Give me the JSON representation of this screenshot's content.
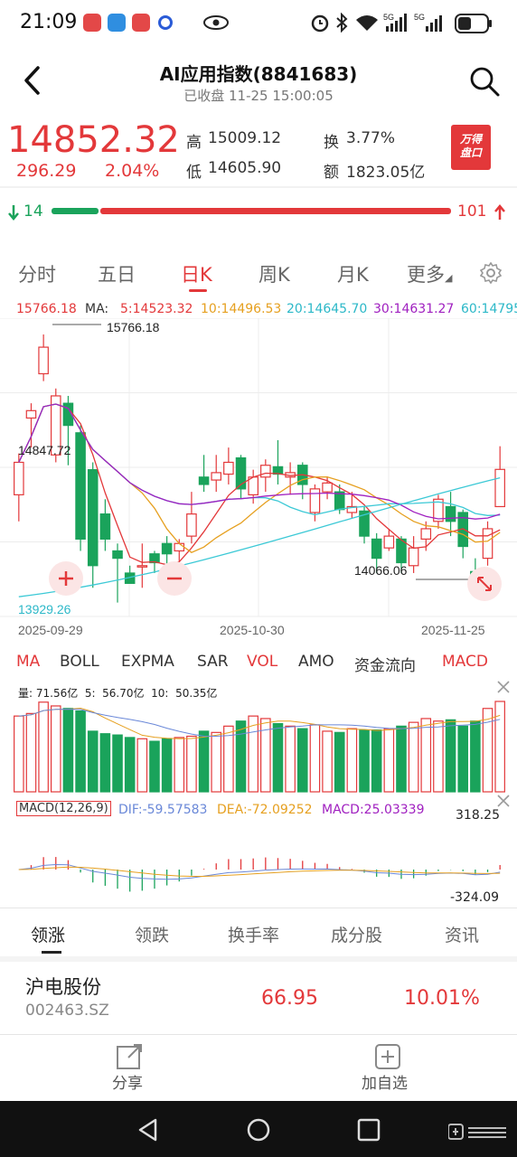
{
  "status": {
    "time": "21:09"
  },
  "header": {
    "title": "AI应用指数(8841683)",
    "subtitle": "已收盘 11-25 15:00:05"
  },
  "quote": {
    "price": "14852.32",
    "change": "296.29",
    "change_pct": "2.04%",
    "high_label": "高",
    "high": "15009.12",
    "low_label": "低",
    "low": "14605.90",
    "turnover_label": "换",
    "turnover": "3.77%",
    "amount_label": "额",
    "amount": "1823.05亿",
    "badge": "万得盘口"
  },
  "breadth": {
    "down": "14",
    "up": "101"
  },
  "period_tabs": [
    "分时",
    "五日",
    "日K",
    "周K",
    "月K",
    "更多"
  ],
  "period_active": "日K",
  "ma_legend": {
    "top_value": "15766.18",
    "ma_label": "MA:",
    "ma5": "5:14523.32",
    "ma10": "10:14496.53",
    "ma20": "20:14645.70",
    "ma30": "30:14631.27",
    "ma60": "60:14795"
  },
  "kchart_labels": {
    "high_mark": "15766.18",
    "mid_level": "14847.72",
    "low_level": "13929.26",
    "low_mark": "14066.06",
    "date1": "2025-09-29",
    "date2": "2025-10-30",
    "date3": "2025-11-25"
  },
  "indicator_tabs": [
    "MA",
    "BOLL",
    "EXPMA",
    "SAR",
    "VOL",
    "AMO",
    "资金流向",
    "MACD"
  ],
  "volume": {
    "label": "量: 71.56亿  5:  56.70亿  10:  50.35亿"
  },
  "macd": {
    "title": "MACD(12,26,9)",
    "dif": "DIF:-59.57583",
    "dea": "DEA:-72.09252",
    "macd": "MACD:25.03339",
    "max": "318.25",
    "min": "-324.09"
  },
  "bottom_tabs": [
    "领涨",
    "领跌",
    "换手率",
    "成分股",
    "资讯"
  ],
  "bottom_active": "领涨",
  "leader": {
    "name": "沪电股份",
    "code": "002463.SZ",
    "price": "66.95",
    "pct": "10.01%"
  },
  "actions": {
    "share": "分享",
    "add": "加自选"
  },
  "colors": {
    "up": "#e3383a",
    "down": "#1aa35b",
    "ma5": "#e3383a",
    "ma10": "#e6a020",
    "ma20": "#3cc9d6",
    "ma30": "#a020c0"
  },
  "chart_data": [
    {
      "type": "candlestick",
      "title": "",
      "ylim": [
        13929.26,
        15766.18
      ],
      "x_ticks": [
        "2025-09-29",
        "2025-10-30",
        "2025-11-25"
      ],
      "candles": [
        {
          "o": 14680,
          "c": 14900,
          "h": 14960,
          "l": 14500
        },
        {
          "o": 15200,
          "c": 15250,
          "h": 15300,
          "l": 15000
        },
        {
          "o": 15500,
          "c": 15680,
          "h": 15766,
          "l": 15450
        },
        {
          "o": 14950,
          "c": 15350,
          "h": 15400,
          "l": 14900
        },
        {
          "o": 15300,
          "c": 15150,
          "h": 15350,
          "l": 14880
        },
        {
          "o": 15100,
          "c": 14380,
          "h": 15150,
          "l": 14300
        },
        {
          "o": 14850,
          "c": 14200,
          "h": 14900,
          "l": 14050
        },
        {
          "o": 14550,
          "c": 14380,
          "h": 14650,
          "l": 14300
        },
        {
          "o": 14300,
          "c": 14250,
          "h": 14350,
          "l": 13950
        },
        {
          "o": 14150,
          "c": 14080,
          "h": 14200,
          "l": 14080
        },
        {
          "o": 14200,
          "c": 14200,
          "h": 14350,
          "l": 14050
        },
        {
          "o": 14280,
          "c": 14220,
          "h": 14300,
          "l": 14150
        },
        {
          "o": 14350,
          "c": 14280,
          "h": 14400,
          "l": 14200
        },
        {
          "o": 14300,
          "c": 14350,
          "h": 14380,
          "l": 14200
        },
        {
          "o": 14400,
          "c": 14550,
          "h": 14700,
          "l": 14350
        },
        {
          "o": 14800,
          "c": 14750,
          "h": 14950,
          "l": 14700
        },
        {
          "o": 14780,
          "c": 14830,
          "h": 14950,
          "l": 14700
        },
        {
          "o": 14820,
          "c": 14900,
          "h": 15000,
          "l": 14750
        },
        {
          "o": 14930,
          "c": 14720,
          "h": 14950,
          "l": 14650
        },
        {
          "o": 14680,
          "c": 14800,
          "h": 14850,
          "l": 14620
        },
        {
          "o": 14800,
          "c": 14880,
          "h": 14920,
          "l": 14700
        },
        {
          "o": 14870,
          "c": 14820,
          "h": 15050,
          "l": 14750
        },
        {
          "o": 14800,
          "c": 14830,
          "h": 14900,
          "l": 14680
        },
        {
          "o": 14880,
          "c": 14750,
          "h": 14900,
          "l": 14650
        },
        {
          "o": 14560,
          "c": 14720,
          "h": 14750,
          "l": 14500
        },
        {
          "o": 14700,
          "c": 14760,
          "h": 14800,
          "l": 14650
        },
        {
          "o": 14700,
          "c": 14580,
          "h": 14750,
          "l": 14550
        },
        {
          "o": 14560,
          "c": 14600,
          "h": 14700,
          "l": 14520
        },
        {
          "o": 14570,
          "c": 14400,
          "h": 14600,
          "l": 14350
        },
        {
          "o": 14380,
          "c": 14250,
          "h": 14420,
          "l": 14150
        },
        {
          "o": 14320,
          "c": 14400,
          "h": 14450,
          "l": 14300
        },
        {
          "o": 14380,
          "c": 14220,
          "h": 14400,
          "l": 14150
        },
        {
          "o": 14200,
          "c": 14320,
          "h": 14400,
          "l": 14150
        },
        {
          "o": 14380,
          "c": 14450,
          "h": 14500,
          "l": 14300
        },
        {
          "o": 14500,
          "c": 14650,
          "h": 14680,
          "l": 14450
        },
        {
          "o": 14600,
          "c": 14500,
          "h": 14700,
          "l": 14400
        },
        {
          "o": 14560,
          "c": 14330,
          "h": 14580,
          "l": 14250
        },
        {
          "o": 14160,
          "c": 14080,
          "h": 14250,
          "l": 14066
        },
        {
          "o": 14250,
          "c": 14450,
          "h": 14500,
          "l": 14200
        },
        {
          "o": 14600,
          "c": 14852,
          "h": 15009,
          "l": 14605
        }
      ],
      "ma_lines": {
        "MA5": 14523.32,
        "MA10": 14496.53,
        "MA20": 14645.7,
        "MA30": 14631.27
      }
    },
    {
      "type": "bar",
      "title": "",
      "series": [
        {
          "name": "量",
          "values": [
            60,
            62,
            71,
            68,
            66,
            64,
            48,
            46,
            45,
            43,
            42,
            40,
            42,
            43,
            44,
            48,
            47,
            52,
            56,
            60,
            58,
            54,
            52,
            50,
            53,
            48,
            47,
            50,
            49,
            49,
            50,
            52,
            55,
            58,
            56,
            57,
            52,
            56,
            66,
            71.56
          ]
        }
      ],
      "ma5": 56.7,
      "ma10": 50.35
    },
    {
      "type": "bar",
      "title": "MACD(12,26,9)",
      "DIF": -59.57583,
      "DEA": -72.09252,
      "MACD": 25.03339,
      "ylim": [
        -324.09,
        318.25
      ]
    }
  ]
}
